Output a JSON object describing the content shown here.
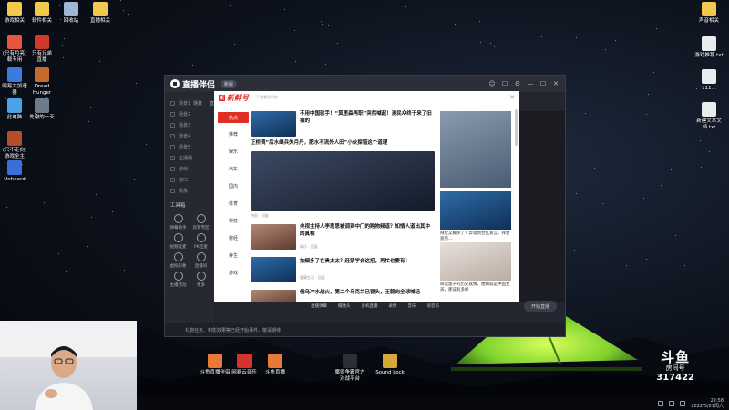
{
  "desktop": {
    "icons_left": [
      {
        "label": "游戏相关",
        "color": "#f2c94c"
      },
      {
        "label": "软件相关",
        "color": "#f2c94c"
      },
      {
        "label": "回收站",
        "color": "#9fb7d1"
      },
      {
        "label": "直播相关",
        "color": "#f2c94c"
      },
      {
        "label": "(只有月亮)\n载专用",
        "color": "#e8553e"
      },
      {
        "label": "只有兄弟\n直播",
        "color": "#d0392c"
      },
      {
        "label": "网易大加速\n器",
        "color": "#3b7be0"
      },
      {
        "label": "Dread\nHunger",
        "color": "#c66a2b"
      },
      {
        "label": "此电脑",
        "color": "#4aa3e8"
      },
      {
        "label": "先谢的一天",
        "color": "#6c7c8c"
      },
      {
        "label": "(只不走向)\n游戏全主",
        "color": "#b44d2a"
      },
      {
        "label": "Unheard",
        "color": "#3c6ed9"
      }
    ],
    "icons_right": [
      {
        "label": "声音相关",
        "color": "#f2c94c"
      },
      {
        "label": "游戏推荐.txt",
        "color": "#e9ecef"
      },
      {
        "label": "111...",
        "color": "#e9ecef"
      },
      {
        "label": "新建文本文\n档.txt",
        "color": "#e9ecef"
      }
    ],
    "icons_bottom": [
      {
        "label": "斗鱼直播伴侣",
        "color": "#e8793a"
      },
      {
        "label": "网易云音乐",
        "color": "#d6322e"
      },
      {
        "label": "斗鱼直播",
        "color": "#e8793a"
      },
      {
        "label": "魔兽争霸官方\n对战平台",
        "color": "#2c2f3a"
      },
      {
        "label": "Sound Lock",
        "color": "#d4a93a"
      }
    ]
  },
  "app": {
    "name": "直播伴侣",
    "version": "新版",
    "win_buttons": [
      "☺",
      "☐",
      "⚙",
      "—",
      "☐",
      "✕"
    ],
    "menu_items": [
      "场景1",
      "场景2",
      "场景3",
      "场景4",
      "场景5",
      "主播播",
      "游戏",
      "窗口",
      "摄像"
    ],
    "tools_title": "工具箱",
    "tools": [
      "弹幕助手",
      "房管专区",
      "视频连麦",
      "PK连麦",
      "虚拟形象",
      "直播间",
      "主播活动",
      "更多"
    ],
    "tabs": [
      "场景",
      "直播"
    ],
    "bottom_tools": [
      "直播弹幕",
      "摄像头",
      "多机直播",
      "录像",
      "音乐",
      "语音员"
    ],
    "status_text": "礼物任务、积影效果等已经开始事件，敬请期待",
    "start_label": "开始直播"
  },
  "news": {
    "logo_badge": "新",
    "logo_text": "新鲜号",
    "slogan": "一下就看到新鲜",
    "categories": [
      "热点",
      "推荐",
      "娱乐",
      "汽车",
      "国内",
      "体育",
      "科技",
      "财经",
      "养生",
      "游戏"
    ],
    "items": [
      {
        "title": "不用中国就手！“莫里森再职”突然喊起！澳民众终于来了旧猫的",
        "meta": ""
      },
      {
        "title": "正桥调“后水继兵失月丹，肥水不流外人田”小伙探错这个道理",
        "meta": "热报 · 回复"
      },
      {
        "title": "央视主持人李思思被调到中门的购物频道？知情人道出其中的真相",
        "meta": "娱乐 · 回复"
      },
      {
        "title": "抽烟多了在贵太太？赶紧学会这招，再忙也要有！",
        "meta": "健康生活 · 回复"
      },
      {
        "title": "俄乌冲水战火，第二个乌克兰已冒头，王毅向全球喊话",
        "meta": ""
      }
    ],
    "side": [
      {
        "title": ""
      },
      {
        "title": "拜登又糊涂了？奔错场合乱发言，拜登竟然..."
      },
      {
        "title": "阅读量子的历史就像，她如就是中国女孩，那该有多好"
      }
    ]
  },
  "stream": {
    "room_logo": "斗鱼",
    "room_label": "房间号",
    "room_number": "317422"
  },
  "taskbar": {
    "time": "22:58",
    "date": "2022/5/21周六"
  }
}
